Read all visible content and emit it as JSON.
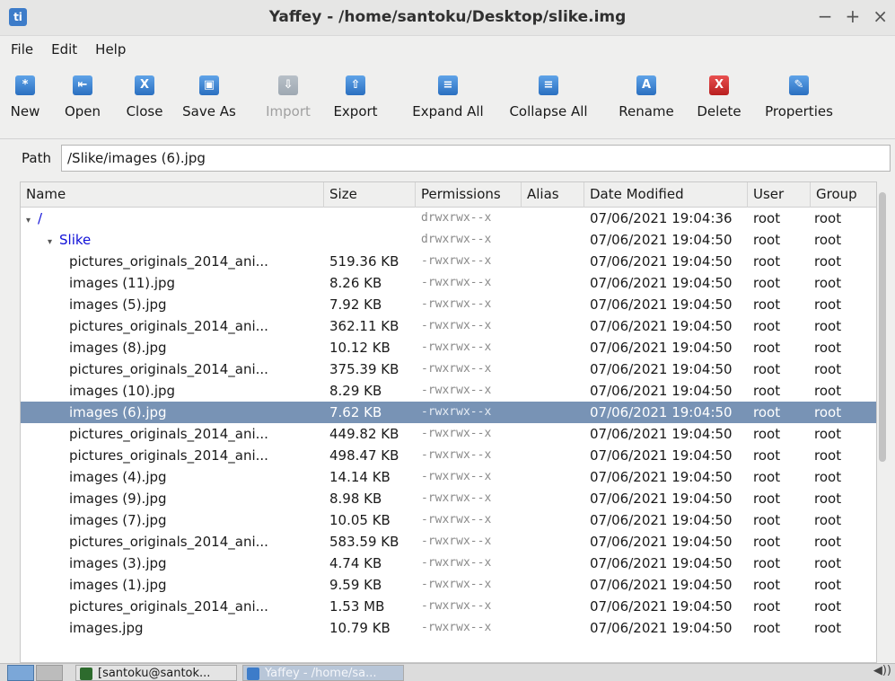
{
  "window": {
    "title": "Yaffey - /home/santoku/Desktop/slike.img",
    "app_icon": "ti",
    "minimize": "−",
    "maximize": "+",
    "close": "×"
  },
  "menu": [
    "File",
    "Edit",
    "Help"
  ],
  "toolbar": [
    {
      "label": "New",
      "glyph": "*",
      "color": "blue",
      "enabled": true,
      "icon": "new-icon"
    },
    {
      "label": "Open",
      "glyph": "⇤",
      "color": "blue",
      "enabled": true,
      "icon": "open-icon"
    },
    {
      "label": "Close",
      "glyph": "X",
      "color": "blue",
      "enabled": true,
      "icon": "close-image-icon"
    },
    {
      "label": "Save As",
      "glyph": "▣",
      "color": "blue",
      "enabled": true,
      "icon": "save-as-icon"
    },
    {
      "label": "Import",
      "glyph": "⇩",
      "color": "gray",
      "enabled": false,
      "icon": "import-icon"
    },
    {
      "label": "Export",
      "glyph": "⇧",
      "color": "blue",
      "enabled": true,
      "icon": "export-icon"
    },
    {
      "label": "Expand All",
      "glyph": "≡",
      "color": "blue",
      "enabled": true,
      "icon": "expand-all-icon"
    },
    {
      "label": "Collapse All",
      "glyph": "≡",
      "color": "blue",
      "enabled": true,
      "icon": "collapse-all-icon"
    },
    {
      "label": "Rename",
      "glyph": "A",
      "color": "blue",
      "enabled": true,
      "icon": "rename-icon"
    },
    {
      "label": "Delete",
      "glyph": "X",
      "color": "red",
      "enabled": true,
      "icon": "delete-icon"
    },
    {
      "label": "Properties",
      "glyph": "✎",
      "color": "blue",
      "enabled": true,
      "icon": "properties-icon"
    }
  ],
  "path": {
    "label": "Path",
    "value": "/Slike/images (6).jpg"
  },
  "columns": [
    "Name",
    "Size",
    "Permissions",
    "Alias",
    "Date Modified",
    "User",
    "Group"
  ],
  "rows": [
    {
      "name": "/",
      "size": "",
      "perm": "drwxrwx--x",
      "alias": "",
      "date": "07/06/2021 19:04:36",
      "user": "root",
      "group": "root",
      "indent": 0,
      "folder": true
    },
    {
      "name": "Slike",
      "size": "",
      "perm": "drwxrwx--x",
      "alias": "",
      "date": "07/06/2021 19:04:50",
      "user": "root",
      "group": "root",
      "indent": 1,
      "folder": true
    },
    {
      "name": "pictures_originals_2014_ani...",
      "size": "519.36 KB",
      "perm": "-rwxrwx--x",
      "alias": "",
      "date": "07/06/2021 19:04:50",
      "user": "root",
      "group": "root",
      "indent": 2
    },
    {
      "name": "images (11).jpg",
      "size": "8.26 KB",
      "perm": "-rwxrwx--x",
      "alias": "",
      "date": "07/06/2021 19:04:50",
      "user": "root",
      "group": "root",
      "indent": 2
    },
    {
      "name": "images (5).jpg",
      "size": "7.92 KB",
      "perm": "-rwxrwx--x",
      "alias": "",
      "date": "07/06/2021 19:04:50",
      "user": "root",
      "group": "root",
      "indent": 2
    },
    {
      "name": "pictures_originals_2014_ani...",
      "size": "362.11 KB",
      "perm": "-rwxrwx--x",
      "alias": "",
      "date": "07/06/2021 19:04:50",
      "user": "root",
      "group": "root",
      "indent": 2
    },
    {
      "name": "images (8).jpg",
      "size": "10.12 KB",
      "perm": "-rwxrwx--x",
      "alias": "",
      "date": "07/06/2021 19:04:50",
      "user": "root",
      "group": "root",
      "indent": 2
    },
    {
      "name": "pictures_originals_2014_ani...",
      "size": "375.39 KB",
      "perm": "-rwxrwx--x",
      "alias": "",
      "date": "07/06/2021 19:04:50",
      "user": "root",
      "group": "root",
      "indent": 2
    },
    {
      "name": "images (10).jpg",
      "size": "8.29 KB",
      "perm": "-rwxrwx--x",
      "alias": "",
      "date": "07/06/2021 19:04:50",
      "user": "root",
      "group": "root",
      "indent": 2
    },
    {
      "name": "images (6).jpg",
      "size": "7.62 KB",
      "perm": "-rwxrwx--x",
      "alias": "",
      "date": "07/06/2021 19:04:50",
      "user": "root",
      "group": "root",
      "indent": 2,
      "selected": true
    },
    {
      "name": "pictures_originals_2014_ani...",
      "size": "449.82 KB",
      "perm": "-rwxrwx--x",
      "alias": "",
      "date": "07/06/2021 19:04:50",
      "user": "root",
      "group": "root",
      "indent": 2
    },
    {
      "name": "pictures_originals_2014_ani...",
      "size": "498.47 KB",
      "perm": "-rwxrwx--x",
      "alias": "",
      "date": "07/06/2021 19:04:50",
      "user": "root",
      "group": "root",
      "indent": 2
    },
    {
      "name": "images (4).jpg",
      "size": "14.14 KB",
      "perm": "-rwxrwx--x",
      "alias": "",
      "date": "07/06/2021 19:04:50",
      "user": "root",
      "group": "root",
      "indent": 2
    },
    {
      "name": "images (9).jpg",
      "size": "8.98 KB",
      "perm": "-rwxrwx--x",
      "alias": "",
      "date": "07/06/2021 19:04:50",
      "user": "root",
      "group": "root",
      "indent": 2
    },
    {
      "name": "images (7).jpg",
      "size": "10.05 KB",
      "perm": "-rwxrwx--x",
      "alias": "",
      "date": "07/06/2021 19:04:50",
      "user": "root",
      "group": "root",
      "indent": 2
    },
    {
      "name": "pictures_originals_2014_ani...",
      "size": "583.59 KB",
      "perm": "-rwxrwx--x",
      "alias": "",
      "date": "07/06/2021 19:04:50",
      "user": "root",
      "group": "root",
      "indent": 2
    },
    {
      "name": "images (3).jpg",
      "size": "4.74 KB",
      "perm": "-rwxrwx--x",
      "alias": "",
      "date": "07/06/2021 19:04:50",
      "user": "root",
      "group": "root",
      "indent": 2
    },
    {
      "name": "images (1).jpg",
      "size": "9.59 KB",
      "perm": "-rwxrwx--x",
      "alias": "",
      "date": "07/06/2021 19:04:50",
      "user": "root",
      "group": "root",
      "indent": 2
    },
    {
      "name": "pictures_originals_2014_ani...",
      "size": "1.53 MB",
      "perm": "-rwxrwx--x",
      "alias": "",
      "date": "07/06/2021 19:04:50",
      "user": "root",
      "group": "root",
      "indent": 2
    },
    {
      "name": "images.jpg",
      "size": "10.79 KB",
      "perm": "-rwxrwx--x",
      "alias": "",
      "date": "07/06/2021 19:04:50",
      "user": "root",
      "group": "root",
      "indent": 2
    }
  ],
  "taskbar": {
    "tasks": [
      "[santoku@santok...",
      "Yaffey - /home/sa..."
    ],
    "volume": "◀))"
  },
  "colors": {
    "selection": "#7893b5",
    "folder": "#1010d8",
    "accent": "#3d7cc9",
    "delete": "#c62828"
  }
}
